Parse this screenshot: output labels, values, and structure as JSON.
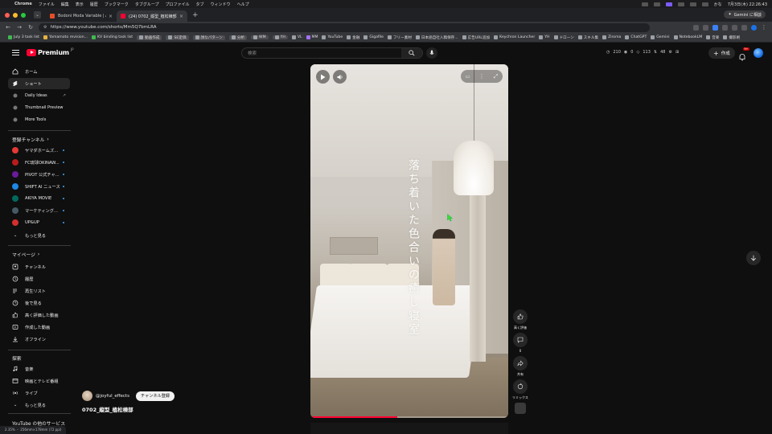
{
  "macbar": {
    "app": "Chrome",
    "menus": [
      "ファイル",
      "編集",
      "表示",
      "履歴",
      "ブックマーク",
      "タブグループ",
      "プロファイル",
      "タブ",
      "ウィンドウ",
      "ヘルプ"
    ],
    "lang": "かな",
    "datetime": "7月3日(木) 22:26:43"
  },
  "tabs": [
    {
      "title": "Bodoni Moda Variable | Adob..."
    },
    {
      "title": "(24) 0702_縦型_植松棟部 - Yo..."
    }
  ],
  "gemini_button": "Gemini に相談",
  "omnibox": {
    "url": "https://www.youtube.com/shorts/Mm5Q7bmLRA"
  },
  "bookmarks": [
    {
      "label": "July 3 task list",
      "color": "#3fb950"
    },
    {
      "label": "Yamamoto revision...",
      "color": "#e3b341"
    },
    {
      "label": "KV binding task list",
      "color": "#3fb950"
    },
    {
      "label": "動画作成",
      "color": "#9aa0a6",
      "tag": true
    },
    {
      "label": "SE定価",
      "color": "#9aa0a6",
      "tag": true
    },
    {
      "label": "顔なパターン",
      "color": "#9aa0a6",
      "tag": true
    },
    {
      "label": "分析",
      "color": "#9aa0a6",
      "tag": true
    },
    {
      "label": "WM",
      "color": "#9aa0a6",
      "tag": true
    },
    {
      "label": "YH",
      "color": "#9aa0a6",
      "tag": true
    },
    {
      "label": "VL",
      "color": "#9aa0a6"
    },
    {
      "label": "MM",
      "color": "#a371f7"
    },
    {
      "label": "YouTube",
      "color": "#9aa0a6"
    },
    {
      "label": "金融",
      "color": "#9aa0a6"
    },
    {
      "label": "Gigafile",
      "color": "#9aa0a6"
    },
    {
      "label": "フリー素材",
      "color": "#9aa0a6"
    },
    {
      "label": "日本語自社入稿保存...",
      "color": "#9aa0a6"
    },
    {
      "label": "広告URL追加",
      "color": "#9aa0a6"
    },
    {
      "label": "Keychron Launcher",
      "color": "#9aa0a6"
    },
    {
      "label": "YH",
      "color": "#9aa0a6"
    },
    {
      "label": "ドローン",
      "color": "#9aa0a6"
    },
    {
      "label": "スキル集",
      "color": "#9aa0a6"
    },
    {
      "label": "Ziroma",
      "color": "#9aa0a6"
    },
    {
      "label": "ChatGPT",
      "color": "#9aa0a6"
    },
    {
      "label": "Gemini",
      "color": "#9aa0a6"
    },
    {
      "label": "NotebookLM",
      "color": "#9aa0a6"
    },
    {
      "label": "音楽",
      "color": "#9aa0a6"
    },
    {
      "label": "撮影術",
      "color": "#9aa0a6"
    }
  ],
  "header": {
    "logo": "Premium",
    "logo_region": "JP",
    "search_placeholder": "検索",
    "stats": [
      "210",
      "0",
      "113",
      "48"
    ],
    "create_label": "作成",
    "notifications": "9+"
  },
  "sidebar": {
    "main_items": [
      {
        "label": "ホーム",
        "icon": "home-icon"
      },
      {
        "label": "ショート",
        "icon": "shorts-icon",
        "active": true
      }
    ],
    "sub_items": [
      {
        "label": "Daily Ideas"
      },
      {
        "label": "Thumbnail Preview"
      },
      {
        "label": "More Tools"
      }
    ],
    "subscriptions_title": "登録チャンネル",
    "subscriptions": [
      {
        "label": "ヤマダホームズ...",
        "color": "#e53935"
      },
      {
        "label": "FC琉球OKINAW...",
        "color": "#b71c1c"
      },
      {
        "label": "PIVOT 公式チャ...",
        "color": "#6a1b9a"
      },
      {
        "label": "SHIFT AI ニュース",
        "color": "#1e88e5"
      },
      {
        "label": "AKIYA MOVIE",
        "color": "#00695c"
      },
      {
        "label": "マーケティング...",
        "color": "#455a64"
      },
      {
        "label": "UP&UP",
        "color": "#d32f2f"
      }
    ],
    "show_more": "もっと見る",
    "you_title": "マイページ",
    "you_items": [
      {
        "label": "チャンネル",
        "icon": "channel-icon"
      },
      {
        "label": "履歴",
        "icon": "history-icon"
      },
      {
        "label": "再生リスト",
        "icon": "playlist-icon"
      },
      {
        "label": "後で見る",
        "icon": "watch-later-icon"
      },
      {
        "label": "高く評価した動画",
        "icon": "liked-icon"
      },
      {
        "label": "作成した動画",
        "icon": "your-videos-icon"
      },
      {
        "label": "オフライン",
        "icon": "download-icon"
      }
    ],
    "explore_title": "探索",
    "explore_items": [
      {
        "label": "音楽",
        "icon": "music-icon"
      },
      {
        "label": "映画とテレビ番組",
        "icon": "movies-icon"
      },
      {
        "label": "ライブ",
        "icon": "live-icon"
      }
    ],
    "show_more_2": "もっと見る",
    "more_services": "YouTube の他のサービス"
  },
  "short": {
    "overlay_text": "落ち着いた色合いの癒し寝室",
    "channel": "@joyful_effects",
    "subscribe_label": "チャンネル登録",
    "title": "0702_縦型_植松棟部",
    "progress": 0.44
  },
  "actions": {
    "like_label": "高く評価",
    "comments_count": "0",
    "share_label": "共有",
    "remix_label": "リミックス"
  },
  "statusbar": "2.35% ・ 256mm×178mm (72 ppi)"
}
